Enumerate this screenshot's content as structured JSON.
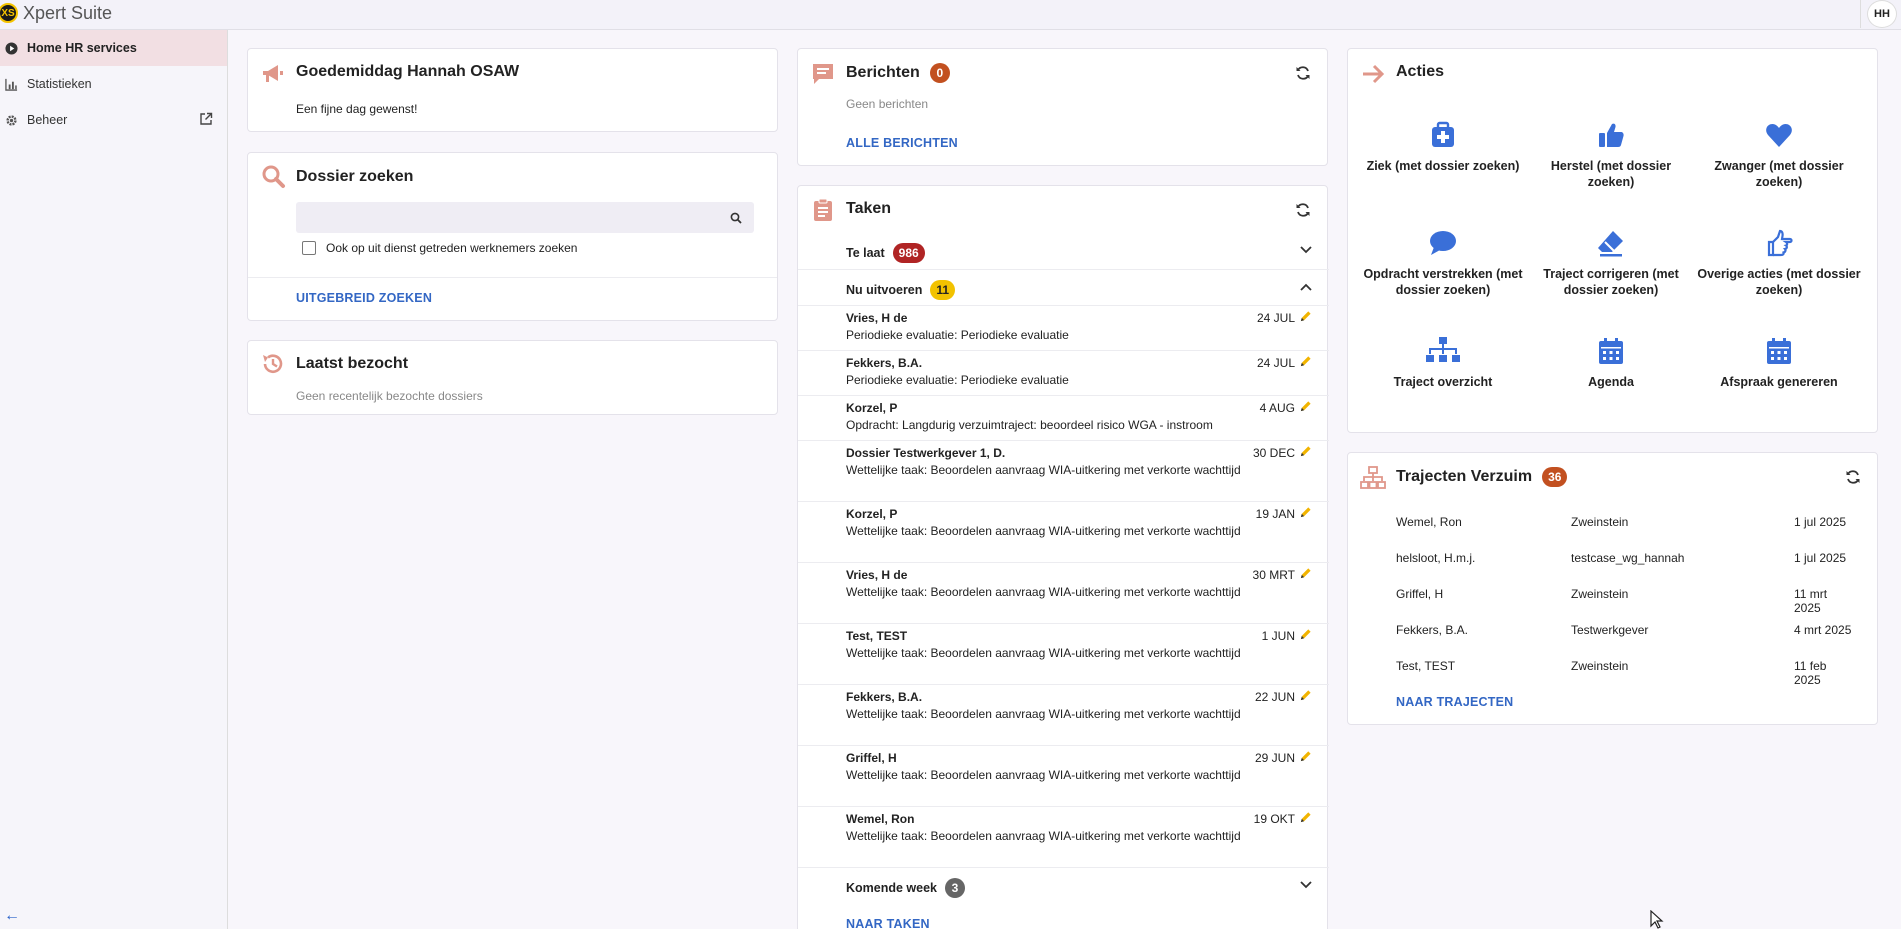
{
  "app": {
    "title": "Xpert Suite",
    "logo_text": "XS",
    "user_initials": "HH"
  },
  "sidebar": {
    "items": [
      {
        "label": "Home HR services",
        "icon": "play-circle-icon"
      },
      {
        "label": "Statistieken",
        "icon": "chart-icon"
      },
      {
        "label": "Beheer",
        "icon": "gear-icon"
      }
    ]
  },
  "greeting": {
    "title": "Goedemiddag Hannah OSAW",
    "text": "Een fijne dag gewenst!"
  },
  "search": {
    "title": "Dossier zoeken",
    "placeholder": "",
    "checkbox_label": "Ook op uit dienst getreden werknemers zoeken",
    "advanced_link": "UITGEBREID ZOEKEN"
  },
  "recent": {
    "title": "Laatst bezocht",
    "empty_text": "Geen recentelijk bezochte dossiers"
  },
  "messages": {
    "title": "Berichten",
    "count": "0",
    "empty_text": "Geen berichten",
    "link": "ALLE BERICHTEN"
  },
  "tasks": {
    "title": "Taken",
    "late": {
      "label": "Te laat",
      "count": "986"
    },
    "now": {
      "label": "Nu uitvoeren",
      "count": "11"
    },
    "items": [
      {
        "name": "Vries, H de",
        "desc": "Periodieke evaluatie: Periodieke evaluatie",
        "date": "24 JUL"
      },
      {
        "name": "Fekkers, B.A.",
        "desc": "Periodieke evaluatie: Periodieke evaluatie",
        "date": "24 JUL"
      },
      {
        "name": "Korzel, P",
        "desc": "Opdracht: Langdurig verzuimtraject: beoordeel risico WGA - instroom",
        "date": "4 AUG"
      },
      {
        "name": "Dossier Testwerkgever 1, D.",
        "desc": "Wettelijke taak: Beoordelen aanvraag WIA-uitkering met verkorte wachttijd",
        "date": "30 DEC"
      },
      {
        "name": "Korzel, P",
        "desc": "Wettelijke taak: Beoordelen aanvraag WIA-uitkering met verkorte wachttijd",
        "date": "19 JAN"
      },
      {
        "name": "Vries, H de",
        "desc": "Wettelijke taak: Beoordelen aanvraag WIA-uitkering met verkorte wachttijd",
        "date": "30 MRT"
      },
      {
        "name": "Test, TEST",
        "desc": "Wettelijke taak: Beoordelen aanvraag WIA-uitkering met verkorte wachttijd",
        "date": "1 JUN"
      },
      {
        "name": "Fekkers, B.A.",
        "desc": "Wettelijke taak: Beoordelen aanvraag WIA-uitkering met verkorte wachttijd",
        "date": "22 JUN"
      },
      {
        "name": "Griffel, H",
        "desc": "Wettelijke taak: Beoordelen aanvraag WIA-uitkering met verkorte wachttijd",
        "date": "29 JUN"
      },
      {
        "name": "Wemel, Ron",
        "desc": "Wettelijke taak: Beoordelen aanvraag WIA-uitkering met verkorte wachttijd",
        "date": "19 OKT"
      }
    ],
    "next_week": {
      "label": "Komende week",
      "count": "3"
    },
    "link": "NAAR TAKEN"
  },
  "actions": {
    "title": "Acties",
    "items": [
      {
        "label": "Ziek (met dossier zoeken)",
        "icon": "medkit-icon"
      },
      {
        "label": "Herstel (met dossier zoeken)",
        "icon": "thumbs-up-icon"
      },
      {
        "label": "Zwanger (met dossier zoeken)",
        "icon": "heart-icon"
      },
      {
        "label": "Opdracht verstrekken (met dossier zoeken)",
        "icon": "chat-bubble-icon"
      },
      {
        "label": "Traject corrigeren (met dossier zoeken)",
        "icon": "eraser-icon"
      },
      {
        "label": "Overige acties (met dossier zoeken)",
        "icon": "hand-pointer-icon"
      },
      {
        "label": "Traject overzicht",
        "icon": "sitemap-icon"
      },
      {
        "label": "Agenda",
        "icon": "calendar-icon"
      },
      {
        "label": "Afspraak genereren",
        "icon": "calendar-icon"
      }
    ]
  },
  "trajects": {
    "title": "Trajecten Verzuim",
    "count": "36",
    "rows": [
      {
        "name": "Wemel, Ron",
        "employer": "Zweinstein",
        "date": "1 jul 2025"
      },
      {
        "name": "helsloot, H.m.j.",
        "employer": "testcase_wg_hannah",
        "date": "1 jul 2025"
      },
      {
        "name": "Griffel, H",
        "employer": "Zweinstein",
        "date": "11 mrt 2025"
      },
      {
        "name": "Fekkers, B.A.",
        "employer": "Testwerkgever",
        "date": "4 mrt 2025"
      },
      {
        "name": "Test, TEST",
        "employer": "Zweinstein",
        "date": "11 feb 2025"
      }
    ],
    "link": "NAAR TRAJECTEN"
  },
  "colors": {
    "accent_icon": "#e0978a",
    "link": "#3367c4",
    "action_icon": "#3a6fd8",
    "active_nav": "#f2dfe3"
  }
}
